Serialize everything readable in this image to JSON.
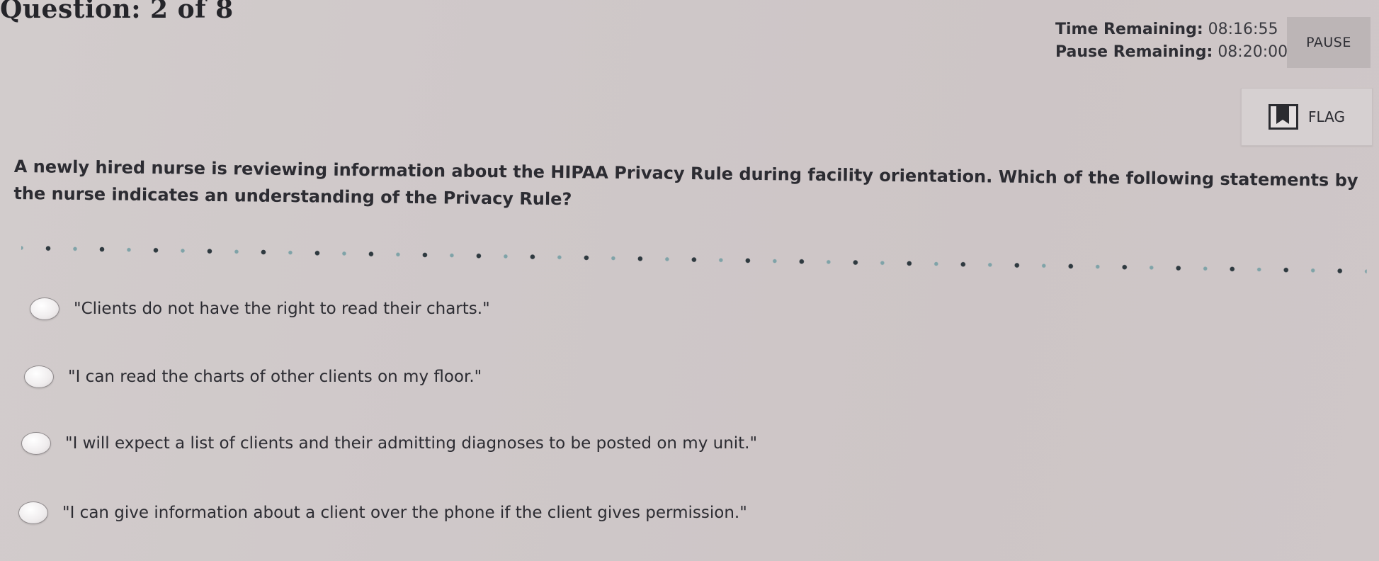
{
  "header": {
    "question_counter": "Question: 2 of 8"
  },
  "timers": {
    "time_remaining_label": "Time Remaining:",
    "time_remaining_value": "08:16:55",
    "pause_remaining_label": "Pause Remaining:",
    "pause_remaining_value": "08:20:00"
  },
  "buttons": {
    "pause_label": "PAUSE",
    "flag_label": "FLAG",
    "flag_icon": "bookmark-flag-icon"
  },
  "question": {
    "text": "A newly hired nurse is reviewing information about the HIPAA Privacy Rule during facility orientation. Which of the following statements by the nurse indicates an understanding of the Privacy Rule?"
  },
  "options": [
    {
      "text": "\"Clients do not have the right to read their charts.\""
    },
    {
      "text": "\"I can read the charts of other clients on my floor.\""
    },
    {
      "text": "\"I will expect a list of clients and their admitting diagnoses to be posted on my unit.\""
    },
    {
      "text": "\"I can give information about a client over the phone if the client gives permission.\""
    }
  ],
  "colors": {
    "background": "#cfc8c9",
    "text": "#2c2c32",
    "divider_dark": "#2f3a40",
    "divider_teal": "#7fa3a8"
  }
}
